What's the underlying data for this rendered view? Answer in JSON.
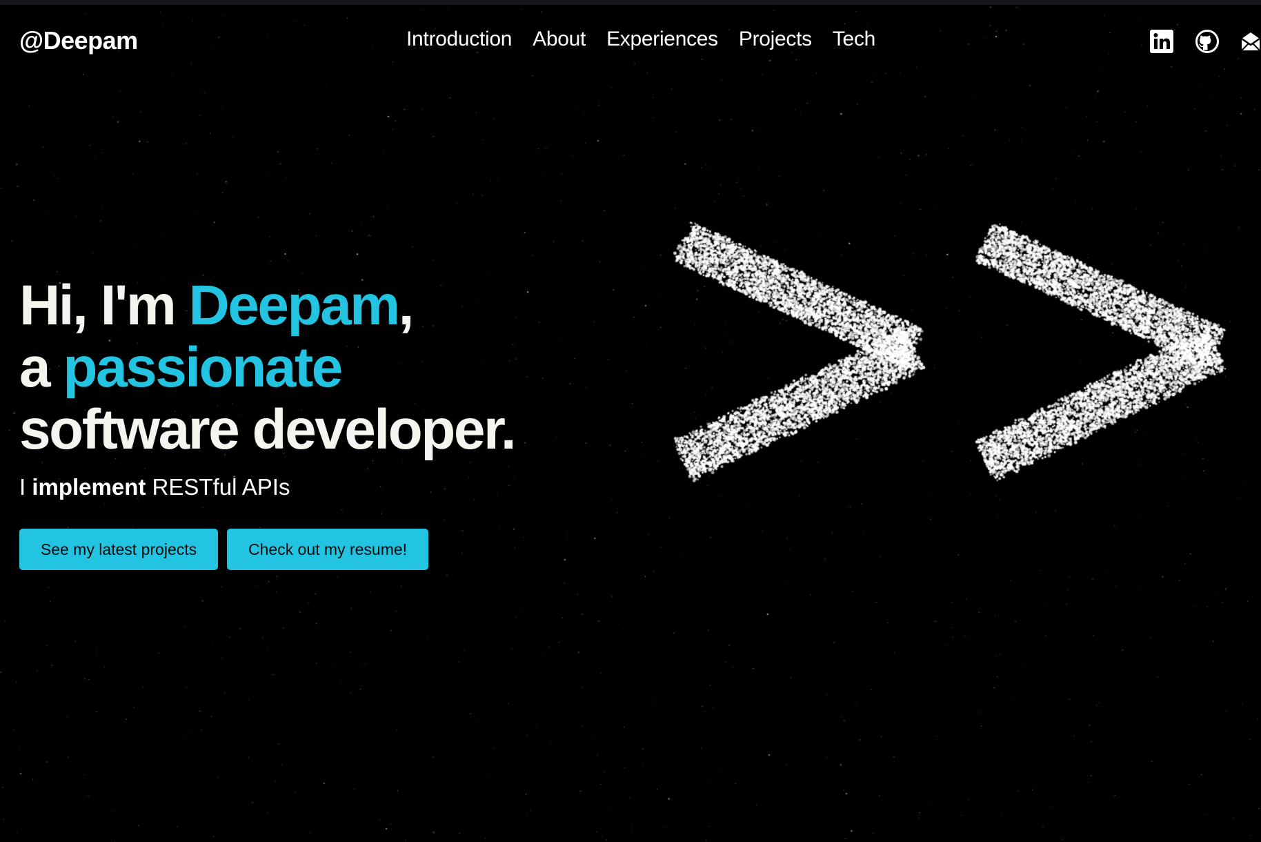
{
  "nav": {
    "brand": "@Deepam",
    "links": [
      "Introduction",
      "About",
      "Experiences",
      "Projects",
      "Tech"
    ],
    "social_icons": [
      "linkedin-icon",
      "github-icon",
      "mail-icon"
    ]
  },
  "hero": {
    "greeting": "Hi, I'm ",
    "name": "Deepam",
    "comma": ",",
    "line2_prefix": "a ",
    "line2_accent": "passionate",
    "line3": "software developer.",
    "tagline_prefix": "I ",
    "tagline_verb": "implement",
    "tagline_object": " RESTful APIs",
    "buttons": {
      "projects": "See my latest projects",
      "resume": "Check out my resume!"
    }
  },
  "graphic": {
    "shape": "double-chevron-particles",
    "glyph": ">>"
  },
  "colors": {
    "background": "#000000",
    "accent": "#22c4e2",
    "text": "#ffffff",
    "particles": "#ffffff"
  }
}
